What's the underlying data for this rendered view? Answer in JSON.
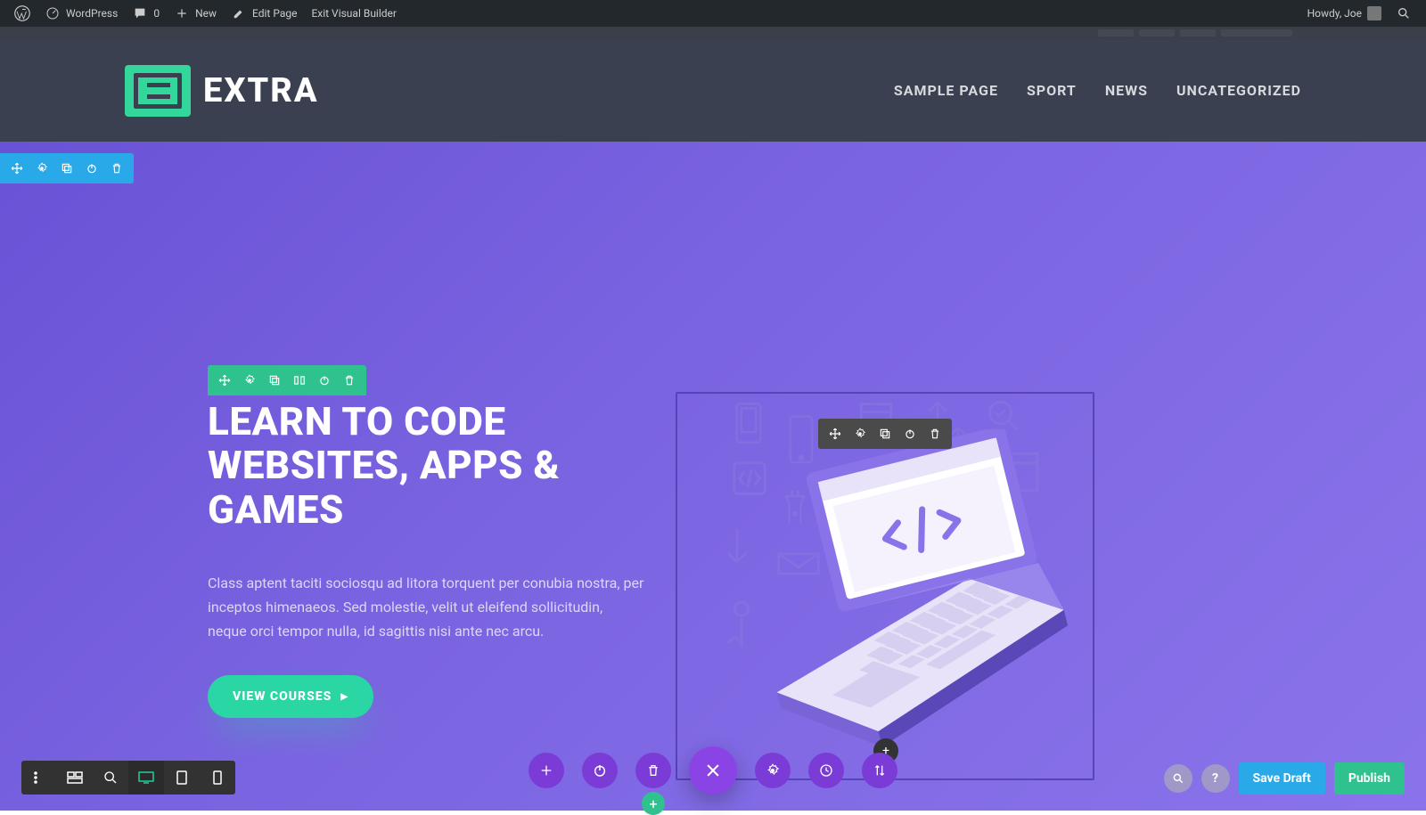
{
  "adminbar": {
    "wordpress_label": "WordPress",
    "comments_count": "0",
    "new_label": "New",
    "edit_page_label": "Edit Page",
    "exit_vb_label": "Exit Visual Builder",
    "howdy_label": "Howdy, Joe"
  },
  "site": {
    "brand": "EXTRA",
    "nav": [
      "SAMPLE PAGE",
      "SPORT",
      "NEWS",
      "UNCATEGORIZED"
    ]
  },
  "hero": {
    "title": "LEARN TO CODE WEBSITES, APPS & GAMES",
    "description": "Class aptent taciti sociosqu ad litora torquent per conubia nostra, per inceptos himenaeos. Sed molestie, velit ut eleifend sollicitudin, neque orci tempor nulla, id sagittis nisi ante nec arcu.",
    "cta_label": "VIEW COURSES"
  },
  "builder": {
    "save_draft_label": "Save Draft",
    "publish_label": "Publish"
  },
  "icons": {
    "move": "move-icon",
    "settings": "gear-icon",
    "duplicate": "duplicate-icon",
    "columns": "columns-icon",
    "power": "power-icon",
    "trash": "trash-icon",
    "plus": "plus-icon",
    "close": "close-icon",
    "history": "history-icon",
    "swap": "swap-icon",
    "zoom": "zoom-icon",
    "help": "help-icon",
    "menu": "menu-icon",
    "wireframe": "wireframe-icon",
    "desktop": "desktop-icon",
    "tablet": "tablet-icon",
    "phone": "phone-icon"
  }
}
